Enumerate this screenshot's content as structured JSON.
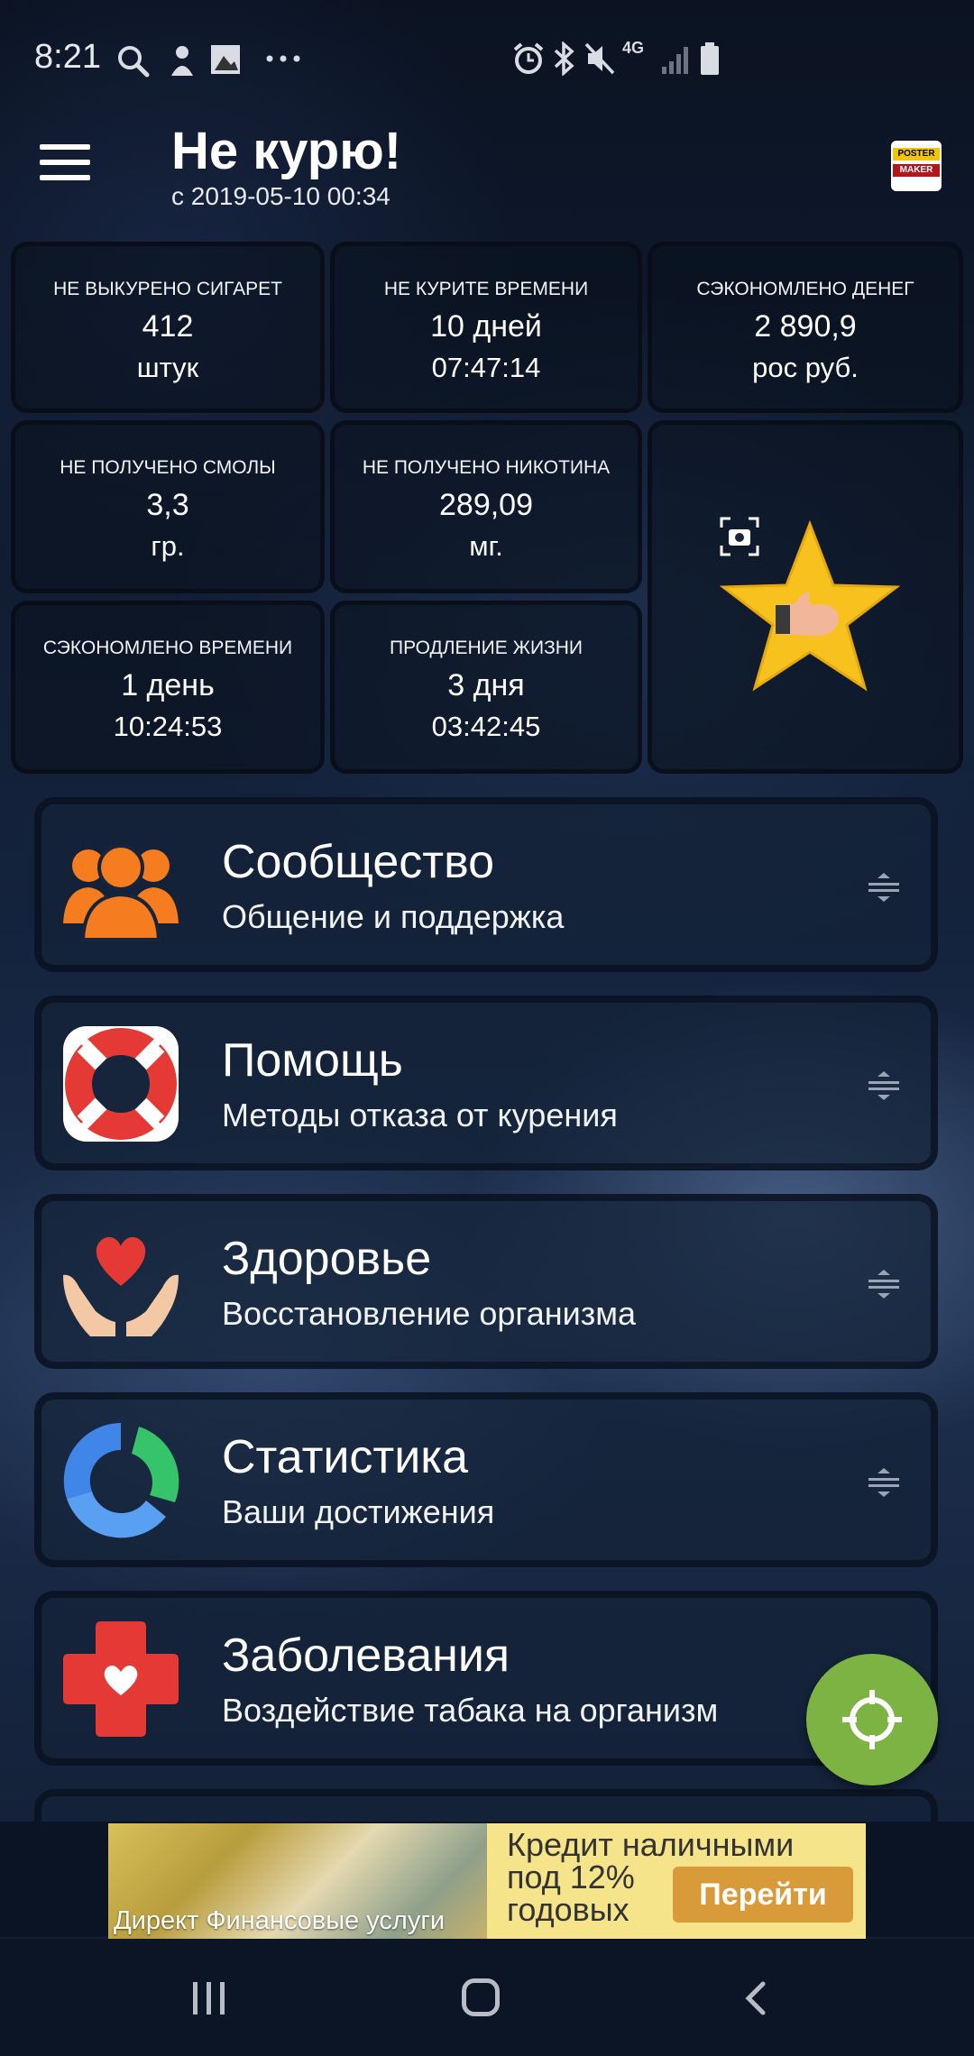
{
  "status_bar": {
    "time": "8:21",
    "left_icons": [
      "search-icon",
      "app-notification-icon",
      "image-icon",
      "more-dots-icon"
    ],
    "right_icons": [
      "alarm-icon",
      "bluetooth-icon",
      "mute-icon",
      "network-4g-icon",
      "signal-icon",
      "battery-icon"
    ],
    "network_label": "4G"
  },
  "toolbar": {
    "title": "Не курю!",
    "subtitle": "с 2019-05-10 00:34",
    "poster_top": "POSTER",
    "poster_bottom": "MAKER"
  },
  "stats": [
    {
      "label": "НЕ ВЫКУРЕНО СИГАРЕТ",
      "value": "412",
      "unit": "штук"
    },
    {
      "label": "НЕ КУРИТЕ ВРЕМЕНИ",
      "value": "10 дней",
      "unit": "07:47:14"
    },
    {
      "label": "СЭКОНОМЛЕНО ДЕНЕГ",
      "value": "2 890,9",
      "unit": "рос руб."
    },
    {
      "label": "НЕ ПОЛУЧЕНО СМОЛЫ",
      "value": "3,3",
      "unit": "гр."
    },
    {
      "label": "НЕ ПОЛУЧЕНО НИКОТИНА",
      "value": "289,09",
      "unit": "мг."
    },
    {
      "label": "СЭКОНОМЛЕНО ВРЕМЕНИ",
      "value": "1 день",
      "unit": "10:24:53"
    },
    {
      "label": "ПРОДЛЕНИЕ ЖИЗНИ",
      "value": "3 дня",
      "unit": "03:42:45"
    }
  ],
  "menu": [
    {
      "title": "Сообщество",
      "subtitle": "Общение и поддержка",
      "icon": "community-icon"
    },
    {
      "title": "Помощь",
      "subtitle": "Методы отказа от курения",
      "icon": "lifebuoy-icon"
    },
    {
      "title": "Здоровье",
      "subtitle": "Восстановление организма",
      "icon": "heart-hands-icon"
    },
    {
      "title": "Статистика",
      "subtitle": "Ваши достижения",
      "icon": "statistics-icon"
    },
    {
      "title": "Заболевания",
      "subtitle": "Воздействие табака на организм",
      "icon": "medical-cross-icon"
    }
  ],
  "ad": {
    "text": "Кредит наличными\nпод 12%\nгодовых",
    "button": "Перейти",
    "caption": "Директ  Финансовые услуги"
  },
  "colors": {
    "fab": "#7cb342",
    "star": "#f7c21e",
    "community": "#f57c1f",
    "lifebuoy": "#e53935",
    "heart": "#e53935",
    "stats_blue": "#3f86e8",
    "stats_green": "#36c46b",
    "ad_button": "#d99a3a"
  }
}
